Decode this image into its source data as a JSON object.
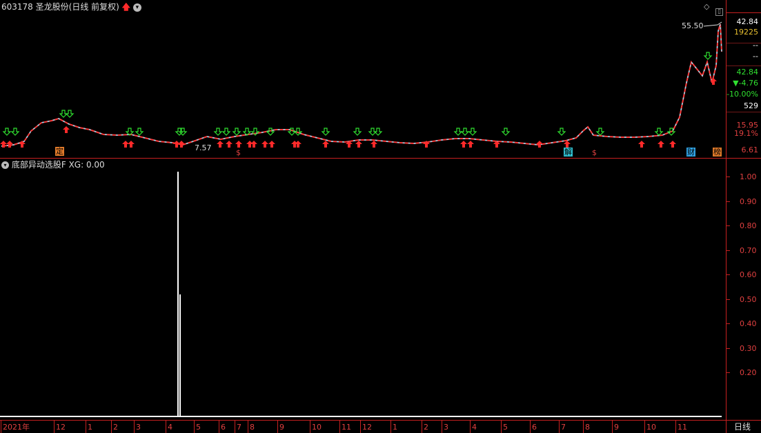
{
  "header": {
    "stock_code": "603178",
    "stock_name": "圣龙股份",
    "period_info": "(日线 前复权)",
    "up_arrow_icon": "red-up-arrow-icon",
    "dropdown_icon": "chevron-down-icon"
  },
  "top_right_controls": {
    "diamond_icon": "diamond-icon",
    "panel_icon": "panel-toggle-icon"
  },
  "price_panel": {
    "high_label": "55.50",
    "low_label": "7.57",
    "badges": [
      {
        "text": "定",
        "color": "#e07a2a"
      },
      {
        "text": "$",
        "color": "#e04040"
      },
      {
        "text": "$",
        "color": "#e04040"
      },
      {
        "text": "解",
        "color": "#30c0d0"
      },
      {
        "text": "财",
        "color": "#30a0e0"
      },
      {
        "text": "榜",
        "color": "#e07a2a"
      }
    ],
    "axis_labels": [
      {
        "text": "42.84",
        "color": "#ffffff"
      },
      {
        "text": "19225",
        "color": "#e8c030"
      },
      {
        "text": "--",
        "color": "#ffffff"
      },
      {
        "text": "--",
        "color": "#ffffff"
      },
      {
        "text": "42.84",
        "color": "#30e030"
      },
      {
        "text": "▼-4.76",
        "color": "#30e030"
      },
      {
        "text": "-10.00%",
        "color": "#30e030"
      },
      {
        "text": "529",
        "color": "#ffffff"
      },
      {
        "text": "15.95",
        "color": "#e04040"
      },
      {
        "text": "19.1%",
        "color": "#e04040"
      },
      {
        "text": "6.61",
        "color": "#e04040"
      }
    ]
  },
  "indicator_panel": {
    "name": "底部异动选股F",
    "value_label": "XG: 0.00",
    "dropdown_icon": "chevron-down-icon",
    "y_ticks": [
      "1.00",
      "0.90",
      "0.80",
      "0.70",
      "0.60",
      "0.50",
      "0.40",
      "0.30",
      "0.20"
    ]
  },
  "chart_data": {
    "type": "line",
    "indicator": "底部异动选股F XG",
    "ylim": [
      0,
      1
    ],
    "signal_spike": {
      "period": "2021-04",
      "value": 1.0
    }
  },
  "bottom_axis": {
    "months": [
      "2021年",
      "12",
      "1",
      "2",
      "3",
      "4",
      "5",
      "6",
      "7",
      "8",
      "9",
      "10",
      "11",
      "12",
      "1",
      "2",
      "3",
      "4",
      "5",
      "6",
      "7",
      "8",
      "9",
      "10",
      "11"
    ],
    "period_button": "日线"
  }
}
